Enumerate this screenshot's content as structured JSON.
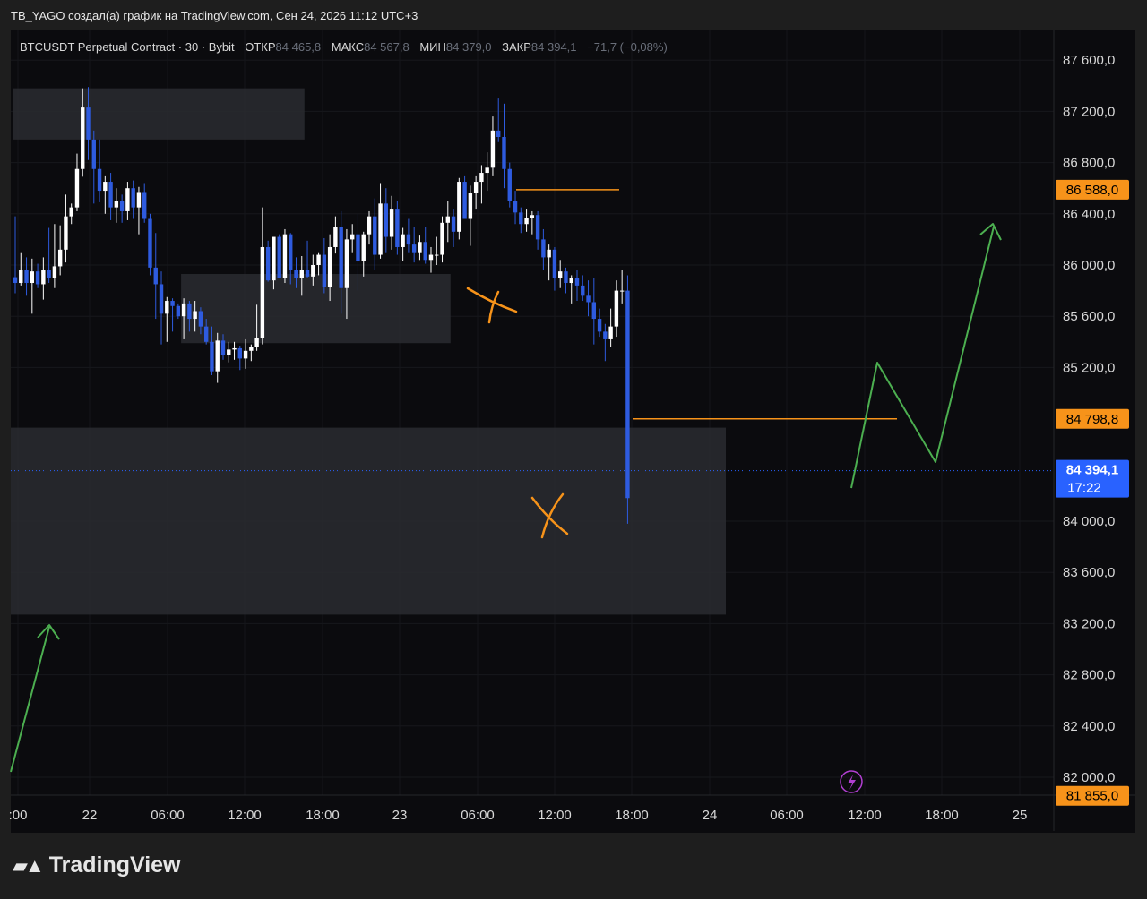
{
  "header": {
    "caption": "TB_YAGO создал(а) график на TradingView.com, Сен 24, 2026 11:12 UTC+3"
  },
  "legend": {
    "symbol": "BTCUSDT Perpetual Contract · 30 · Bybit",
    "open_label": "ОТКР",
    "open_value": "84 465,8",
    "high_label": "МАКС",
    "high_value": "84 567,8",
    "low_label": "МИН",
    "low_value": "84 379,0",
    "close_label": "ЗАКР",
    "close_value": "84 394,1",
    "change": "−71,7 (−0,08%)"
  },
  "badges": {
    "level_high": "86 588,0",
    "level_mid": "84 798,8",
    "last_price": "84 394,1",
    "countdown": "17:22",
    "level_low": "81 855,0"
  },
  "logo": {
    "text": "TradingView"
  },
  "colors": {
    "background": "#0b0b0e",
    "bull": "#ffffff",
    "bear": "#2e5bdf",
    "zone": "#2a2b30",
    "level": "#f7931a",
    "arrow": "#4caf50",
    "last_price_badge": "#2962ff"
  },
  "chart_data": {
    "type": "candlestick",
    "timeframe": "30",
    "y_ticks": [
      "87 600,0",
      "87 200,0",
      "86 800,0",
      "86 400,0",
      "86 000,0",
      "85 600,0",
      "85 200,0",
      "84 000,0",
      "83 600,0",
      "83 200,0",
      "82 800,0",
      "82 400,0",
      "82 000,0"
    ],
    "x_ticks": [
      ":00",
      "22",
      "06:00",
      "12:00",
      "18:00",
      "23",
      "06:00",
      "12:00",
      "18:00",
      "24",
      "06:00",
      "12:00",
      "18:00",
      "25"
    ],
    "ylim": [
      81820,
      87750
    ],
    "price_levels": [
      86588.0,
      84798.8,
      84394.1,
      81855.0
    ],
    "zones": [
      {
        "start_index": 0,
        "end_index": 51,
        "top": 87380,
        "bottom": 86980
      },
      {
        "start_index": 30,
        "end_index": 77,
        "top": 85930,
        "bottom": 85390
      },
      {
        "start_index": -10,
        "end_index": 126,
        "top": 84730,
        "bottom": 83270
      }
    ],
    "candles": [
      {
        "o": 85905,
        "h": 86380,
        "l": 85780,
        "c": 85860
      },
      {
        "o": 85860,
        "h": 86100,
        "l": 85840,
        "c": 85960
      },
      {
        "o": 85960,
        "h": 86060,
        "l": 85760,
        "c": 85860
      },
      {
        "o": 85860,
        "h": 86050,
        "l": 85620,
        "c": 85950
      },
      {
        "o": 85950,
        "h": 86010,
        "l": 85820,
        "c": 85850
      },
      {
        "o": 85850,
        "h": 86060,
        "l": 85730,
        "c": 85960
      },
      {
        "o": 85960,
        "h": 86290,
        "l": 85860,
        "c": 85900
      },
      {
        "o": 85900,
        "h": 86320,
        "l": 85820,
        "c": 85990
      },
      {
        "o": 85990,
        "h": 86310,
        "l": 85920,
        "c": 86120
      },
      {
        "o": 86120,
        "h": 86550,
        "l": 86020,
        "c": 86380
      },
      {
        "o": 86380,
        "h": 86480,
        "l": 86320,
        "c": 86450
      },
      {
        "o": 86450,
        "h": 86870,
        "l": 86420,
        "c": 86750
      },
      {
        "o": 86750,
        "h": 87380,
        "l": 86690,
        "c": 87230
      },
      {
        "o": 87230,
        "h": 87390,
        "l": 86820,
        "c": 86980
      },
      {
        "o": 86980,
        "h": 87050,
        "l": 86480,
        "c": 86750
      },
      {
        "o": 86750,
        "h": 86980,
        "l": 86490,
        "c": 86580
      },
      {
        "o": 86580,
        "h": 86700,
        "l": 86400,
        "c": 86650
      },
      {
        "o": 86650,
        "h": 86720,
        "l": 86350,
        "c": 86450
      },
      {
        "o": 86450,
        "h": 86600,
        "l": 86330,
        "c": 86500
      },
      {
        "o": 86500,
        "h": 86550,
        "l": 86330,
        "c": 86420
      },
      {
        "o": 86420,
        "h": 86650,
        "l": 86350,
        "c": 86600
      },
      {
        "o": 86600,
        "h": 86660,
        "l": 86360,
        "c": 86450
      },
      {
        "o": 86450,
        "h": 86610,
        "l": 86240,
        "c": 86570
      },
      {
        "o": 86570,
        "h": 86640,
        "l": 86330,
        "c": 86360
      },
      {
        "o": 86360,
        "h": 86400,
        "l": 85920,
        "c": 85980
      },
      {
        "o": 85980,
        "h": 86250,
        "l": 85580,
        "c": 85850
      },
      {
        "o": 85850,
        "h": 85950,
        "l": 85380,
        "c": 85620
      },
      {
        "o": 85620,
        "h": 85750,
        "l": 85400,
        "c": 85720
      },
      {
        "o": 85720,
        "h": 85740,
        "l": 85480,
        "c": 85680
      },
      {
        "o": 85680,
        "h": 85700,
        "l": 85580,
        "c": 85600
      },
      {
        "o": 85600,
        "h": 85740,
        "l": 85420,
        "c": 85700
      },
      {
        "o": 85700,
        "h": 85720,
        "l": 85480,
        "c": 85580
      },
      {
        "o": 85580,
        "h": 85720,
        "l": 85480,
        "c": 85640
      },
      {
        "o": 85640,
        "h": 85670,
        "l": 85460,
        "c": 85520
      },
      {
        "o": 85520,
        "h": 85580,
        "l": 85380,
        "c": 85400
      },
      {
        "o": 85400,
        "h": 85520,
        "l": 85140,
        "c": 85170
      },
      {
        "o": 85170,
        "h": 85470,
        "l": 85080,
        "c": 85410
      },
      {
        "o": 85410,
        "h": 85460,
        "l": 85260,
        "c": 85300
      },
      {
        "o": 85300,
        "h": 85400,
        "l": 85240,
        "c": 85340
      },
      {
        "o": 85340,
        "h": 85400,
        "l": 85260,
        "c": 85350
      },
      {
        "o": 85350,
        "h": 85370,
        "l": 85180,
        "c": 85270
      },
      {
        "o": 85270,
        "h": 85420,
        "l": 85190,
        "c": 85330
      },
      {
        "o": 85330,
        "h": 85380,
        "l": 85250,
        "c": 85360
      },
      {
        "o": 85360,
        "h": 85690,
        "l": 85330,
        "c": 85430
      },
      {
        "o": 85430,
        "h": 86450,
        "l": 85380,
        "c": 86140
      },
      {
        "o": 86140,
        "h": 86190,
        "l": 85870,
        "c": 85880
      },
      {
        "o": 85880,
        "h": 86200,
        "l": 85810,
        "c": 86220
      },
      {
        "o": 86220,
        "h": 86240,
        "l": 85900,
        "c": 85900
      },
      {
        "o": 85900,
        "h": 86280,
        "l": 85860,
        "c": 86240
      },
      {
        "o": 86240,
        "h": 86250,
        "l": 85850,
        "c": 85960
      },
      {
        "o": 85960,
        "h": 86060,
        "l": 85820,
        "c": 85900
      },
      {
        "o": 85900,
        "h": 86070,
        "l": 85760,
        "c": 85960
      },
      {
        "o": 85960,
        "h": 86190,
        "l": 85900,
        "c": 85910
      },
      {
        "o": 85910,
        "h": 86080,
        "l": 85840,
        "c": 86000
      },
      {
        "o": 86000,
        "h": 86100,
        "l": 85920,
        "c": 86080
      },
      {
        "o": 86080,
        "h": 86210,
        "l": 85780,
        "c": 85830
      },
      {
        "o": 85830,
        "h": 86240,
        "l": 85720,
        "c": 86140
      },
      {
        "o": 86140,
        "h": 86380,
        "l": 86090,
        "c": 86300
      },
      {
        "o": 86300,
        "h": 86420,
        "l": 85620,
        "c": 85820
      },
      {
        "o": 85820,
        "h": 86280,
        "l": 85580,
        "c": 86200
      },
      {
        "o": 86200,
        "h": 86320,
        "l": 86100,
        "c": 86240
      },
      {
        "o": 86240,
        "h": 86400,
        "l": 85800,
        "c": 86030
      },
      {
        "o": 86030,
        "h": 86260,
        "l": 85910,
        "c": 86240
      },
      {
        "o": 86240,
        "h": 86420,
        "l": 86160,
        "c": 86380
      },
      {
        "o": 86380,
        "h": 86520,
        "l": 85960,
        "c": 86080
      },
      {
        "o": 86080,
        "h": 86640,
        "l": 86050,
        "c": 86480
      },
      {
        "o": 86480,
        "h": 86600,
        "l": 86100,
        "c": 86220
      },
      {
        "o": 86220,
        "h": 86540,
        "l": 86120,
        "c": 86440
      },
      {
        "o": 86440,
        "h": 86500,
        "l": 86080,
        "c": 86140
      },
      {
        "o": 86140,
        "h": 86290,
        "l": 86030,
        "c": 86240
      },
      {
        "o": 86240,
        "h": 86360,
        "l": 86100,
        "c": 86160
      },
      {
        "o": 86160,
        "h": 86300,
        "l": 86020,
        "c": 86100
      },
      {
        "o": 86100,
        "h": 86230,
        "l": 86040,
        "c": 86180
      },
      {
        "o": 86180,
        "h": 86300,
        "l": 86010,
        "c": 86040
      },
      {
        "o": 86040,
        "h": 86140,
        "l": 85940,
        "c": 86080
      },
      {
        "o": 86080,
        "h": 86220,
        "l": 86000,
        "c": 86080
      },
      {
        "o": 86080,
        "h": 86380,
        "l": 86020,
        "c": 86330
      },
      {
        "o": 86330,
        "h": 86500,
        "l": 86180,
        "c": 86380
      },
      {
        "o": 86380,
        "h": 86440,
        "l": 86140,
        "c": 86260
      },
      {
        "o": 86260,
        "h": 86680,
        "l": 86200,
        "c": 86650
      },
      {
        "o": 86650,
        "h": 86700,
        "l": 86360,
        "c": 86360
      },
      {
        "o": 86360,
        "h": 86620,
        "l": 86150,
        "c": 86560
      },
      {
        "o": 86560,
        "h": 86700,
        "l": 86440,
        "c": 86650
      },
      {
        "o": 86650,
        "h": 86780,
        "l": 86480,
        "c": 86720
      },
      {
        "o": 86720,
        "h": 86880,
        "l": 86580,
        "c": 86760
      },
      {
        "o": 86760,
        "h": 87160,
        "l": 86700,
        "c": 87050
      },
      {
        "o": 87050,
        "h": 87300,
        "l": 86960,
        "c": 87000
      },
      {
        "o": 87000,
        "h": 87260,
        "l": 86600,
        "c": 86750
      },
      {
        "o": 86750,
        "h": 86800,
        "l": 86450,
        "c": 86500
      },
      {
        "o": 86500,
        "h": 86580,
        "l": 86320,
        "c": 86410
      },
      {
        "o": 86410,
        "h": 86450,
        "l": 86250,
        "c": 86320
      },
      {
        "o": 86320,
        "h": 86440,
        "l": 86260,
        "c": 86370
      },
      {
        "o": 86370,
        "h": 86420,
        "l": 86240,
        "c": 86390
      },
      {
        "o": 86390,
        "h": 86420,
        "l": 86120,
        "c": 86200
      },
      {
        "o": 86200,
        "h": 86280,
        "l": 85960,
        "c": 86060
      },
      {
        "o": 86060,
        "h": 86160,
        "l": 85880,
        "c": 86120
      },
      {
        "o": 86120,
        "h": 86140,
        "l": 85800,
        "c": 85900
      },
      {
        "o": 85900,
        "h": 86040,
        "l": 85820,
        "c": 85950
      },
      {
        "o": 85950,
        "h": 85980,
        "l": 85780,
        "c": 85860
      },
      {
        "o": 85860,
        "h": 85920,
        "l": 85700,
        "c": 85900
      },
      {
        "o": 85900,
        "h": 85960,
        "l": 85720,
        "c": 85840
      },
      {
        "o": 85840,
        "h": 85920,
        "l": 85720,
        "c": 85760
      },
      {
        "o": 85760,
        "h": 85880,
        "l": 85600,
        "c": 85710
      },
      {
        "o": 85710,
        "h": 85900,
        "l": 85380,
        "c": 85580
      },
      {
        "o": 85580,
        "h": 85660,
        "l": 85440,
        "c": 85480
      },
      {
        "o": 85480,
        "h": 85540,
        "l": 85250,
        "c": 85420
      },
      {
        "o": 85420,
        "h": 85660,
        "l": 85360,
        "c": 85520
      },
      {
        "o": 85520,
        "h": 85880,
        "l": 85440,
        "c": 85800
      },
      {
        "o": 85800,
        "h": 85960,
        "l": 85700,
        "c": 85800
      },
      {
        "o": 85800,
        "h": 85920,
        "l": 83980,
        "c": 84180
      }
    ]
  }
}
